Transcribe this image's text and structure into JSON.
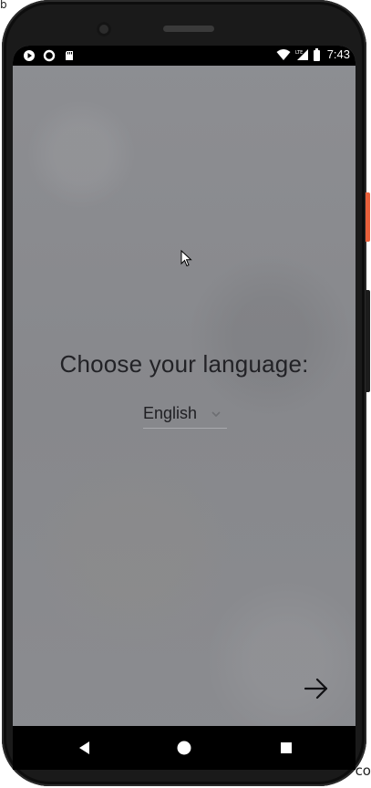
{
  "stray": {
    "top_left": "b",
    "bottom_right": "co"
  },
  "statusbar": {
    "time": "7:43",
    "network": "LTE",
    "icons_left": [
      "play-store-icon",
      "circle-icon",
      "sd-card-icon"
    ],
    "icons_right": [
      "wifi-icon",
      "lte-signal-icon",
      "battery-icon"
    ]
  },
  "onboarding": {
    "title": "Choose your language:",
    "language_select": {
      "selected": "English"
    },
    "next_icon": "arrow-right-icon"
  },
  "navbar": {
    "buttons": [
      "back-triangle-icon",
      "home-circle-icon",
      "recents-square-icon"
    ]
  },
  "colors": {
    "screen_background": "#8a8b8f",
    "text": "#222226",
    "bars": "#000000",
    "side_button_accent": "#e8603b"
  }
}
